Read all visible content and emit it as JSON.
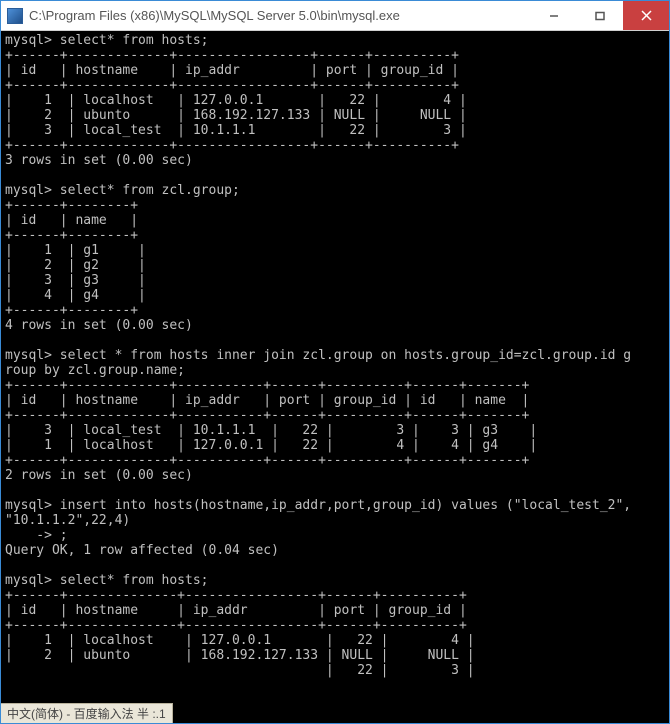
{
  "window": {
    "title": "C:\\Program Files (x86)\\MySQL\\MySQL Server 5.0\\bin\\mysql.exe",
    "icon_name": "cmd-icon",
    "minimize": "min",
    "maximize": "max",
    "close": "close"
  },
  "prompt": "mysql>",
  "cont_prompt": "->",
  "queries": {
    "q1": "select* from hosts;",
    "q2": "select* from zcl.group;",
    "q3": "select * from hosts inner join zcl.group on hosts.group_id=zcl.group.id group by zcl.group.name;",
    "q4_line1": "insert into hosts(hostname,ip_addr,port,group_id) values (\"local_test_2\",\"10.1.1.2\",22,4)",
    "q4_line2": ";",
    "q5": "select* from hosts;"
  },
  "results": {
    "hosts": {
      "columns": [
        "id",
        "hostname",
        "ip_addr",
        "port",
        "group_id"
      ],
      "rows": [
        {
          "id": 1,
          "hostname": "localhost",
          "ip_addr": "127.0.0.1",
          "port": "22",
          "group_id": "4"
        },
        {
          "id": 2,
          "hostname": "ubunto",
          "ip_addr": "168.192.127.133",
          "port": "NULL",
          "group_id": "NULL"
        },
        {
          "id": 3,
          "hostname": "local_test",
          "ip_addr": "10.1.1.1",
          "port": "22",
          "group_id": "3"
        }
      ],
      "footer": "3 rows in set (0.00 sec)"
    },
    "group": {
      "columns": [
        "id",
        "name"
      ],
      "rows": [
        {
          "id": 1,
          "name": "g1"
        },
        {
          "id": 2,
          "name": "g2"
        },
        {
          "id": 3,
          "name": "g3"
        },
        {
          "id": 4,
          "name": "g4"
        }
      ],
      "footer": "4 rows in set (0.00 sec)"
    },
    "join": {
      "columns": [
        "id",
        "hostname",
        "ip_addr",
        "port",
        "group_id",
        "id",
        "name"
      ],
      "rows": [
        {
          "id": 3,
          "hostname": "local_test",
          "ip_addr": "10.1.1.1",
          "port": "22",
          "group_id": "3",
          "id2": 3,
          "name": "g3"
        },
        {
          "id": 1,
          "hostname": "localhost",
          "ip_addr": "127.0.0.1",
          "port": "22",
          "group_id": "4",
          "id2": 4,
          "name": "g4"
        }
      ],
      "footer": "2 rows in set (0.00 sec)"
    },
    "insert": {
      "footer": "Query OK, 1 row affected (0.04 sec)"
    },
    "hosts2": {
      "columns": [
        "id",
        "hostname",
        "ip_addr",
        "port",
        "group_id"
      ],
      "rows": [
        {
          "id": 1,
          "hostname": "localhost",
          "ip_addr": "127.0.0.1",
          "port": "22",
          "group_id": "4"
        },
        {
          "id": 2,
          "hostname": "ubunto",
          "ip_addr": "168.192.127.133",
          "port": "NULL",
          "group_id": "NULL"
        },
        {
          "id_partial": "22",
          "group_id_partial": "3"
        }
      ]
    }
  },
  "ime": {
    "text": "中文(简体) - 百度输入法 半 :.1"
  }
}
